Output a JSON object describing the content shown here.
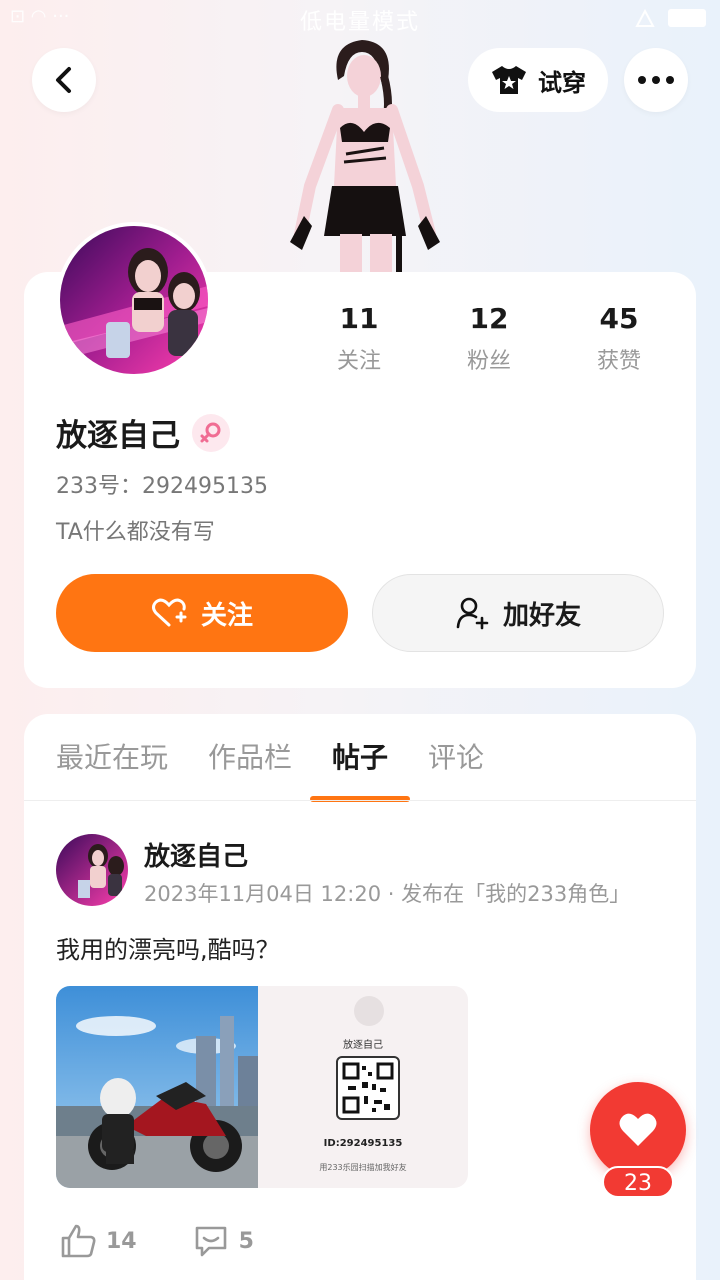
{
  "status_bar": {
    "mode_text": "低电量模式",
    "left_icons": "⊡ ◠ ···"
  },
  "header": {
    "try_on_label": "试穿"
  },
  "profile": {
    "stats": [
      {
        "value": "11",
        "label": "关注"
      },
      {
        "value": "12",
        "label": "粉丝"
      },
      {
        "value": "45",
        "label": "获赞"
      }
    ],
    "name": "放逐自己",
    "id_text": "233号：292495135",
    "bio": "TA什么都没有写",
    "follow_label": "关注",
    "add_friend_label": "加好友"
  },
  "tabs": [
    "最近在玩",
    "作品栏",
    "帖子",
    "评论"
  ],
  "active_tab_index": 2,
  "post": {
    "author": "放逐自己",
    "meta": "2023年11月04日 12:20 · 发布在「我的233角色」",
    "text": "我用的漂亮吗,酷吗？",
    "card_name": "放逐自己",
    "card_id": "ID:292495135",
    "card_hint": "用233乐园扫描加我好友",
    "likes": "14",
    "comments": "5"
  },
  "like_fab_count": "23",
  "colors": {
    "accent": "#ff7512",
    "like": "#f23a33"
  }
}
